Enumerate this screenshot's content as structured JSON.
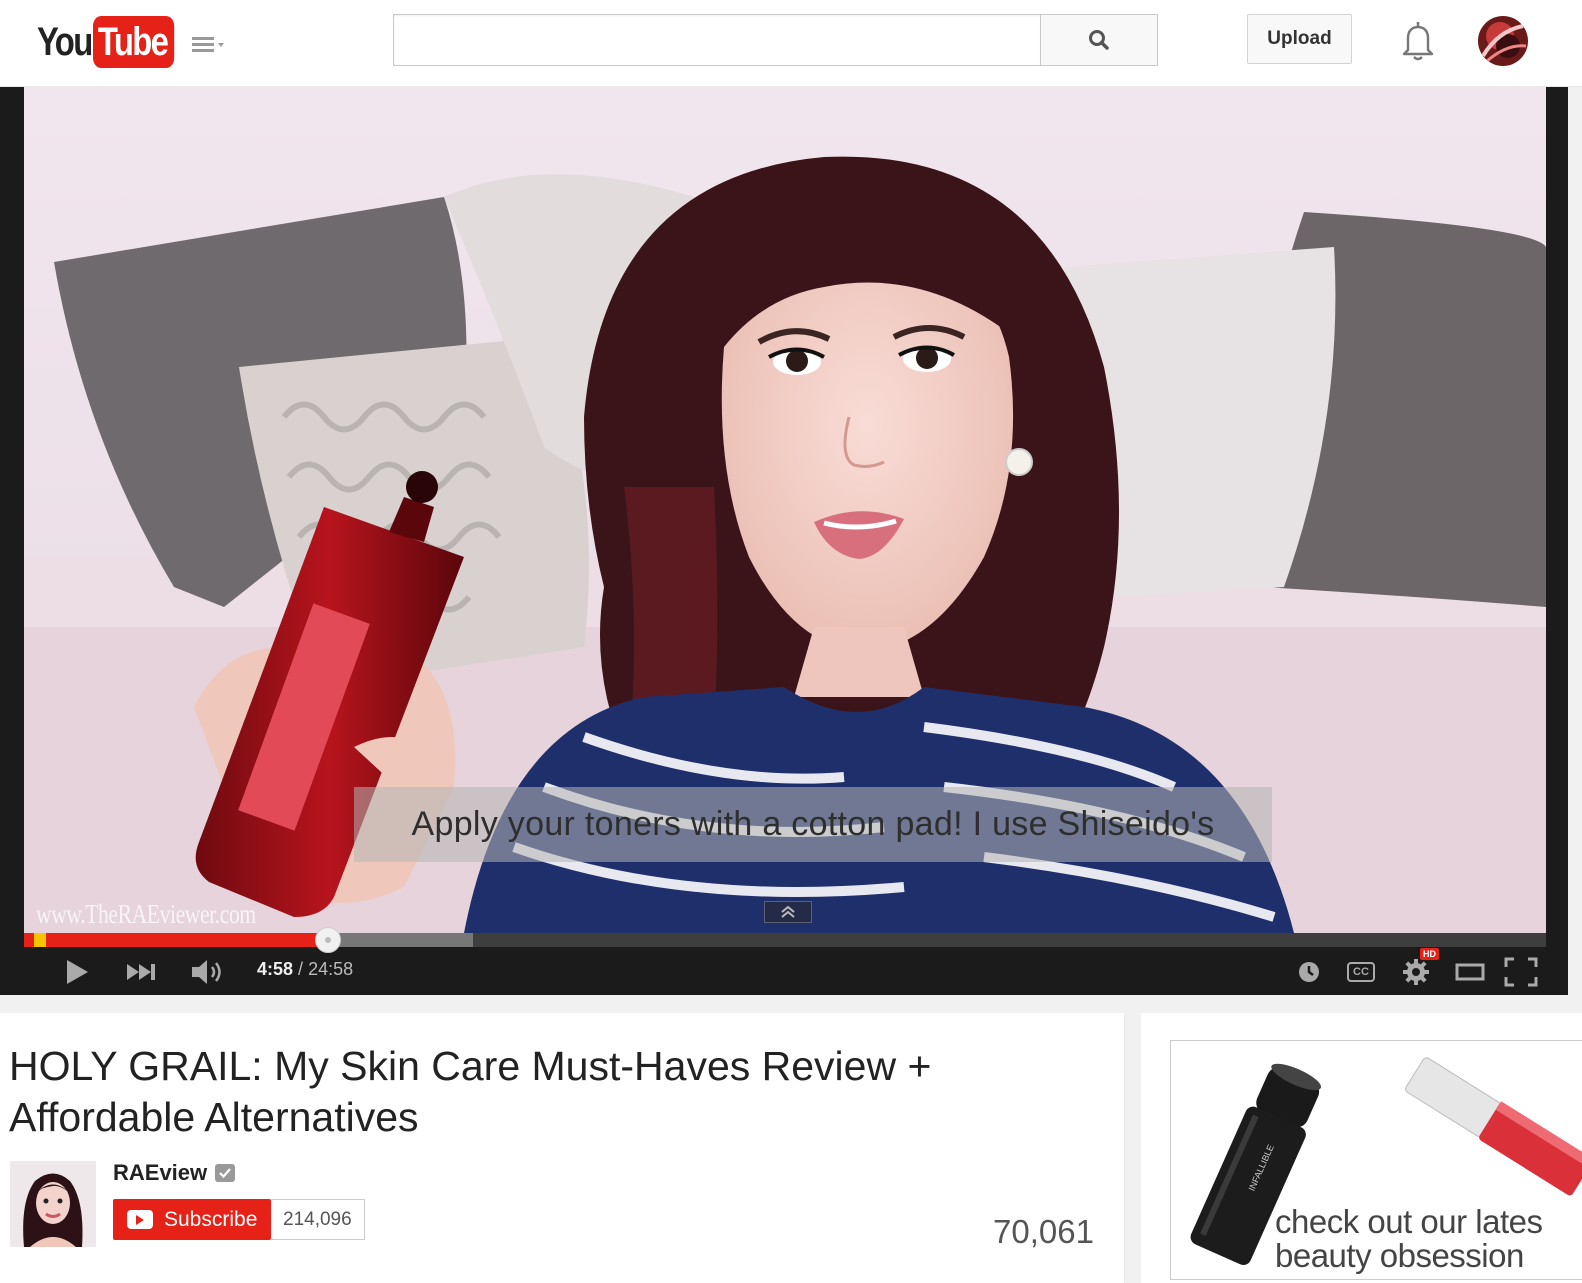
{
  "masthead": {
    "logo_you": "You",
    "logo_tube": "Tube",
    "search_placeholder": "",
    "upload_label": "Upload"
  },
  "player": {
    "caption": "Apply your toners with a cotton pad! I use Shiseido's",
    "watermark": "www.TheRAEviewer.com",
    "current_time": "4:58",
    "time_separator": "/",
    "duration": "24:58",
    "played_fraction": 0.2,
    "buffered_fraction": 0.295,
    "hd_badge": "HD",
    "cc_label": "CC"
  },
  "video_info": {
    "title": "HOLY GRAIL: My Skin Care Must-Haves Review + Affordable Alternatives",
    "channel_name": "RAEview",
    "subscribe_label": "Subscribe",
    "subscriber_count": "214,096",
    "view_count": "70,061"
  },
  "ad": {
    "text_line1": "check out our lates",
    "text_line2": "beauty obsession",
    "product1_label": "INFALLIBLE"
  },
  "colors": {
    "brand_red": "#e62117",
    "ad_marker_yellow": "#f7c500",
    "player_background": "#1b1b1b"
  }
}
